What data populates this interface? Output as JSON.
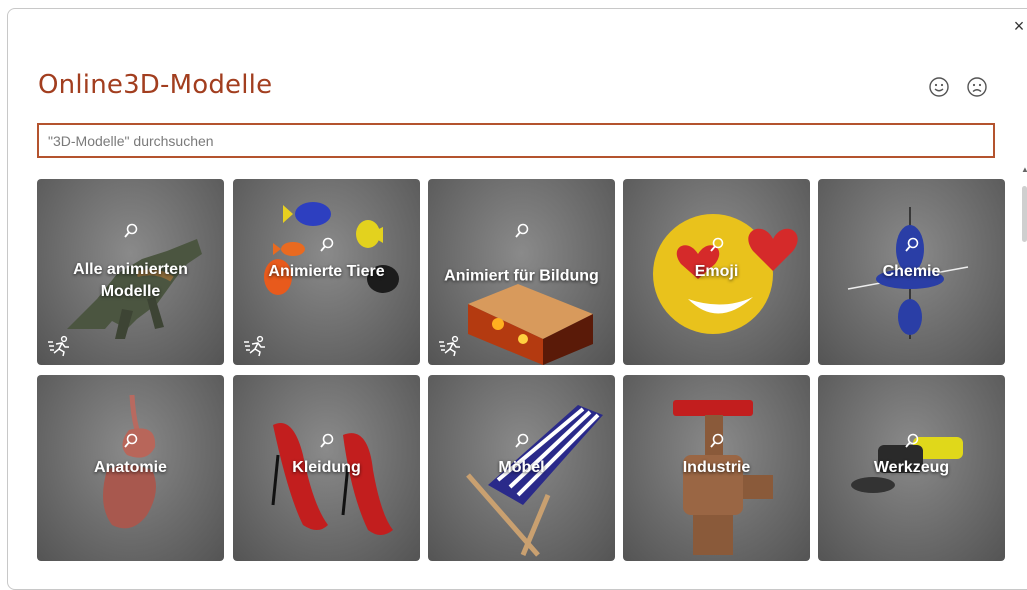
{
  "dialog": {
    "title": "Online3D-Modelle",
    "close_label": "×"
  },
  "search": {
    "placeholder": "\"3D-Modelle\" durchsuchen",
    "value": ""
  },
  "feedback": {
    "smile": "smiley-icon",
    "frown": "frowny-icon"
  },
  "colors": {
    "accent": "#a23e1f",
    "search_border": "#b4532e"
  },
  "categories": [
    {
      "label": "Alle animierten Modelle",
      "animated": true,
      "icon": "dinosaur"
    },
    {
      "label": "Animierte Tiere",
      "animated": true,
      "icon": "fish"
    },
    {
      "label": "Animiert für Bildung",
      "animated": true,
      "icon": "lava-block"
    },
    {
      "label": "Emoji",
      "animated": false,
      "icon": "heart-eyes-emoji"
    },
    {
      "label": "Chemie",
      "animated": false,
      "icon": "orbital"
    },
    {
      "label": "Anatomie",
      "animated": false,
      "icon": "digestive-system"
    },
    {
      "label": "Kleidung",
      "animated": false,
      "icon": "high-heels"
    },
    {
      "label": "Möbel",
      "animated": false,
      "icon": "deck-chair"
    },
    {
      "label": "Industrie",
      "animated": false,
      "icon": "valve"
    },
    {
      "label": "Werkzeug",
      "animated": false,
      "icon": "angle-grinder"
    }
  ]
}
